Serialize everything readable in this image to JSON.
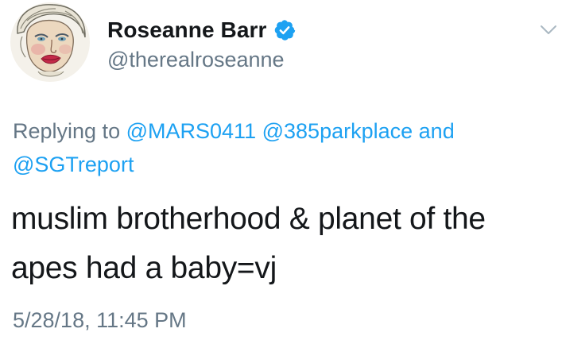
{
  "user": {
    "display_name": "Roseanne Barr",
    "handle": "@therealroseanne",
    "verified": true,
    "avatar_icon": "caricature-portrait-avatar"
  },
  "reply": {
    "prefix": "Replying to",
    "mentions": [
      "@MARS0411",
      "@385parkplace",
      "@SGTreport"
    ],
    "conjunction": "and"
  },
  "tweet": {
    "text": "muslim brotherhood & planet of the apes had a baby=vj",
    "timestamp": "5/28/18, 11:45 PM"
  },
  "colors": {
    "link": "#1da1f2",
    "secondary_text": "#657786",
    "primary_text": "#14171a",
    "verified_badge": "#1da1f2"
  },
  "icons": {
    "verified": "verified-badge-icon",
    "menu": "chevron-down-icon"
  }
}
